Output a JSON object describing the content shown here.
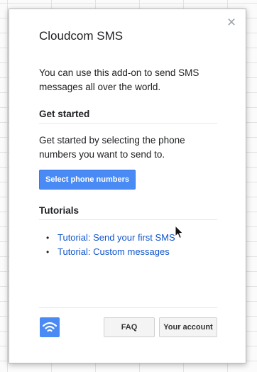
{
  "dialog": {
    "title": "Cloudcom SMS",
    "close_glyph": "×",
    "intro": "You can use this add-on to send SMS messages all over the world."
  },
  "get_started": {
    "heading": "Get started",
    "text": "Get started by selecting the phone numbers you want to send to.",
    "button_label": "Select phone numbers"
  },
  "tutorials": {
    "heading": "Tutorials",
    "items": [
      {
        "label": "Tutorial: Send your first SMS"
      },
      {
        "label": "Tutorial: Custom messages"
      }
    ]
  },
  "footer": {
    "logo_icon": "wifi-signal-icon",
    "faq_label": "FAQ",
    "account_label": "Your account"
  },
  "colors": {
    "accent": "#4a8af4",
    "link": "#1155cc"
  }
}
